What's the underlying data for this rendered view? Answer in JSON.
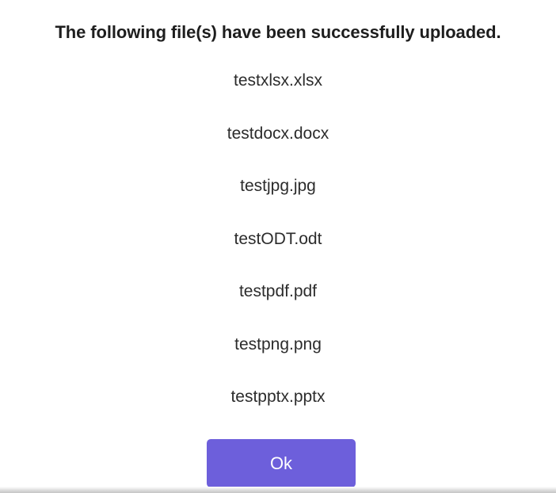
{
  "dialog": {
    "title": "The following file(s) have been successfully uploaded.",
    "files": [
      "testxlsx.xlsx",
      "testdocx.docx",
      "testjpg.jpg",
      "testODT.odt",
      "testpdf.pdf",
      "testpng.png",
      "testpptx.pptx"
    ],
    "ok_label": "Ok",
    "colors": {
      "button_background": "#6d5fdb",
      "button_text": "#ffffff"
    }
  }
}
